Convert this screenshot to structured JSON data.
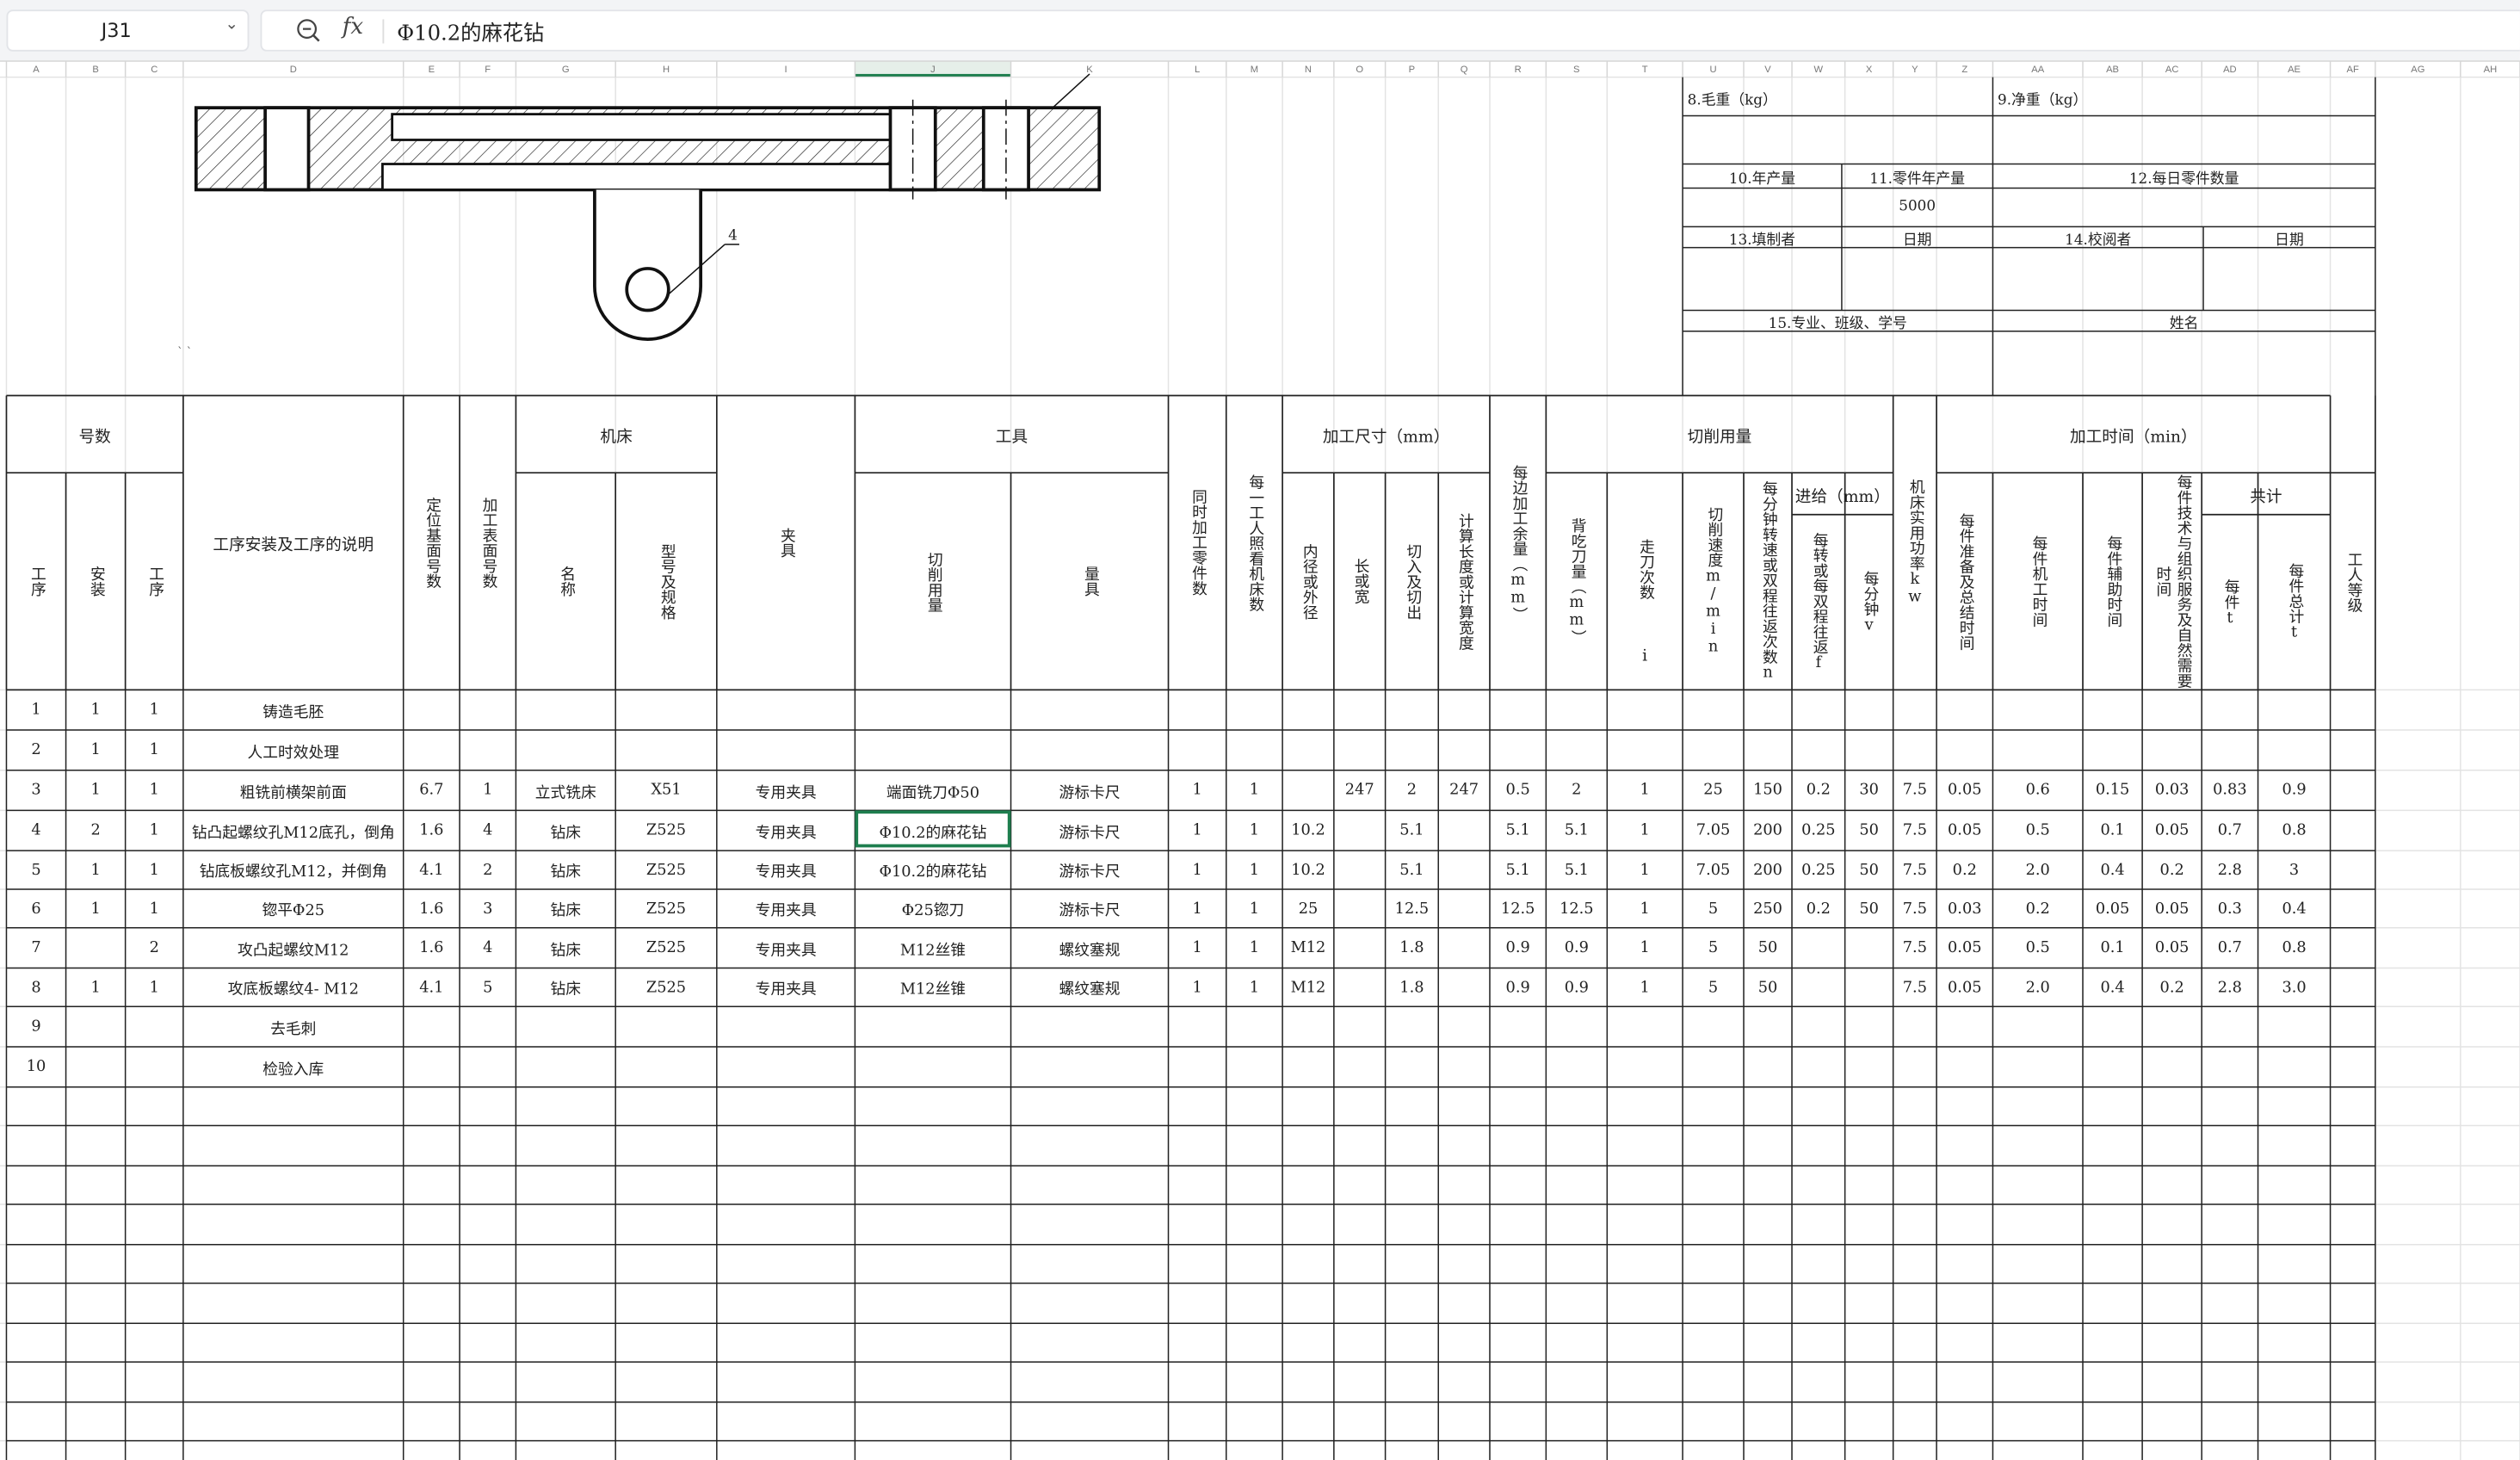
{
  "formula_bar": {
    "cell_ref": "J31",
    "fx_symbol": "fx",
    "content": "Φ10.2的麻花钻"
  },
  "column_headers": [
    "A",
    "B",
    "C",
    "D",
    "E",
    "F",
    "G",
    "H",
    "I",
    "J",
    "K",
    "L",
    "M",
    "N",
    "O",
    "P",
    "Q",
    "R",
    "S",
    "T",
    "U",
    "V",
    "W",
    "X",
    "Y",
    "Z",
    "AA",
    "AB",
    "AC",
    "AD",
    "AE",
    "AF",
    "AG",
    "AH"
  ],
  "drawing": {
    "callout_label": "4",
    "stray_marks": "` `"
  },
  "info_block": {
    "gross_weight_label": "8.毛重（kg）",
    "net_weight_label": "9.净重（kg）",
    "annual_output_label": "10.年产量",
    "annual_part_output_label": "11.零件年产量",
    "annual_part_output_value": "5000",
    "daily_part_count_label": "12.每日零件数量",
    "prepared_by_label": "13.填制者",
    "date_label_1": "日期",
    "reviewed_by_label": "14.校阅者",
    "date_label_2": "日期",
    "major_class_id_label": "15.专业、班级、学号",
    "name_label": "姓名"
  },
  "table_headers": {
    "number_group": "号数",
    "process": "工序",
    "setup": "安装",
    "step": "工序",
    "description": "工序安装及工序的说明",
    "locating_surface": "定位基面号数",
    "machined_surface": "加工表面号数",
    "machine_group": "机床",
    "machine_name": "名称",
    "machine_model": "型号及规格",
    "fixture": "夹具",
    "tool_group": "工具",
    "cutting_tool": "切削用量",
    "measuring_tool": "量具",
    "simultaneous_parts": "同时加工零件数",
    "machines_per_worker": "每一工人照看机床数",
    "dimension_group": "加工尺寸（mm）",
    "inner_outer_dia": "内径或外径",
    "length_width": "长或宽",
    "cut_in_out": "切入及切出",
    "calc_length": "计算长度或计算宽度",
    "allowance": "每边加工余量（mm）",
    "cutting_group": "切削用量",
    "depth_of_cut": "背吃刀量（mm）",
    "passes": "走刀次数",
    "passes_i": "i",
    "cutting_speed": "切削速度m/min",
    "rpm": "每分钟转速或双程往返次数n",
    "feed_group": "进给（mm）",
    "feed_per_rev": "每转或每双程往返f",
    "feed_per_min": "每分钟v",
    "power": "机床实用功率kw",
    "time_group": "加工时间（min）",
    "prep_time": "每件准备及总结时间",
    "machine_time": "每件机工时间",
    "aux_time": "每件辅助时间",
    "service_time": "每件技术与组织服务及自然需要时间",
    "total_group": "共计",
    "per_piece": "每件t",
    "per_piece_total": "每件总计t",
    "worker_grade": "工人等级"
  },
  "rows": [
    [
      "1",
      "1",
      "1",
      "铸造毛胚",
      "",
      "",
      "",
      "",
      "",
      "",
      "",
      "",
      "",
      "",
      "",
      "",
      "",
      "",
      "",
      "",
      "",
      "",
      "",
      "",
      "",
      "",
      "",
      "",
      "",
      "",
      "",
      ""
    ],
    [
      "2",
      "1",
      "1",
      "人工时效处理",
      "",
      "",
      "",
      "",
      "",
      "",
      "",
      "",
      "",
      "",
      "",
      "",
      "",
      "",
      "",
      "",
      "",
      "",
      "",
      "",
      "",
      "",
      "",
      "",
      "",
      "",
      "",
      ""
    ],
    [
      "3",
      "1",
      "1",
      "粗铣前横架前面",
      "6.7",
      "1",
      "立式铣床",
      "X51",
      "专用夹具",
      "端面铣刀Φ50",
      "游标卡尺",
      "1",
      "1",
      "",
      "247",
      "2",
      "247",
      "0.5",
      "2",
      "1",
      "25",
      "150",
      "0.2",
      "30",
      "7.5",
      "0.05",
      "0.6",
      "0.15",
      "0.03",
      "0.83",
      "0.9",
      ""
    ],
    [
      "4",
      "2",
      "1",
      "钻凸起螺纹孔M12底孔，倒角",
      "1.6",
      "4",
      "钻床",
      "Z525",
      "专用夹具",
      "Φ10.2的麻花钻",
      "游标卡尺",
      "1",
      "1",
      "10.2",
      "",
      "5.1",
      "",
      "5.1",
      "5.1",
      "1",
      "7.05",
      "200",
      "0.25",
      "50",
      "7.5",
      "0.05",
      "0.5",
      "0.1",
      "0.05",
      "0.7",
      "0.8",
      ""
    ],
    [
      "5",
      "1",
      "1",
      "钻底板螺纹孔M12，并倒角",
      "4.1",
      "2",
      "钻床",
      "Z525",
      "专用夹具",
      "Φ10.2的麻花钻",
      "游标卡尺",
      "1",
      "1",
      "10.2",
      "",
      "5.1",
      "",
      "5.1",
      "5.1",
      "1",
      "7.05",
      "200",
      "0.25",
      "50",
      "7.5",
      "0.2",
      "2.0",
      "0.4",
      "0.2",
      "2.8",
      "3",
      ""
    ],
    [
      "6",
      "1",
      "1",
      "锪平Φ25",
      "1.6",
      "3",
      "钻床",
      "Z525",
      "专用夹具",
      "Φ25锪刀",
      "游标卡尺",
      "1",
      "1",
      "25",
      "",
      "12.5",
      "",
      "12.5",
      "12.5",
      "1",
      "5",
      "250",
      "0.2",
      "50",
      "7.5",
      "0.03",
      "0.2",
      "0.05",
      "0.05",
      "0.3",
      "0.4",
      ""
    ],
    [
      "7",
      "",
      "2",
      "攻凸起螺纹M12",
      "1.6",
      "4",
      "钻床",
      "Z525",
      "专用夹具",
      "M12丝锥",
      "螺纹塞规",
      "1",
      "1",
      "M12",
      "",
      "1.8",
      "",
      "0.9",
      "0.9",
      "1",
      "5",
      "50",
      "",
      "",
      "7.5",
      "0.05",
      "0.5",
      "0.1",
      "0.05",
      "0.7",
      "0.8",
      ""
    ],
    [
      "8",
      "1",
      "1",
      "攻底板螺纹4- M12",
      "4.1",
      "5",
      "钻床",
      "Z525",
      "专用夹具",
      "M12丝锥",
      "螺纹塞规",
      "1",
      "1",
      "M12",
      "",
      "1.8",
      "",
      "0.9",
      "0.9",
      "1",
      "5",
      "50",
      "",
      "",
      "7.5",
      "0.05",
      "2.0",
      "0.4",
      "0.2",
      "2.8",
      "3.0",
      ""
    ],
    [
      "9",
      "",
      "",
      "去毛刺",
      "",
      "",
      "",
      "",
      "",
      "",
      "",
      "",
      "",
      "",
      "",
      "",
      "",
      "",
      "",
      "",
      "",
      "",
      "",
      "",
      "",
      "",
      "",
      "",
      "",
      "",
      "",
      ""
    ],
    [
      "10",
      "",
      "",
      "检验入库",
      "",
      "",
      "",
      "",
      "",
      "",
      "",
      "",
      "",
      "",
      "",
      "",
      "",
      "",
      "",
      "",
      "",
      "",
      "",
      "",
      "",
      "",
      "",
      "",
      "",
      "",
      "",
      ""
    ]
  ],
  "colors": {
    "toolbar_bg": "#f3f4f6",
    "grid_line": "#e3e3e3",
    "border_line": "#222222",
    "selection": "#1e7e4e"
  }
}
